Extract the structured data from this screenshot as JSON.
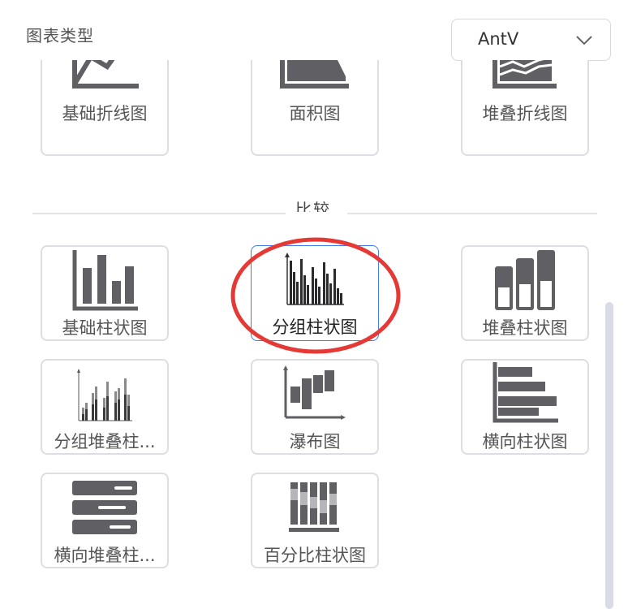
{
  "panel": {
    "title": "图表类型"
  },
  "library_select": {
    "value": "AntV",
    "icon": "chevron-down-icon"
  },
  "top_row": [
    {
      "label": "基础折线图",
      "icon": "line-chart-icon"
    },
    {
      "label": "面积图",
      "icon": "area-chart-icon"
    },
    {
      "label": "堆叠折线图",
      "icon": "stacked-line-chart-icon"
    }
  ],
  "section": {
    "title": "比较"
  },
  "compare_charts": [
    {
      "label": "基础柱状图",
      "icon": "bar-chart-icon"
    },
    {
      "label": "分组柱状图",
      "icon": "grouped-bar-chart-icon",
      "selected": true
    },
    {
      "label": "堆叠柱状图",
      "icon": "stacked-bar-chart-icon"
    },
    {
      "label": "分组堆叠柱...",
      "icon": "grouped-stacked-bar-chart-icon"
    },
    {
      "label": "瀑布图",
      "icon": "waterfall-chart-icon"
    },
    {
      "label": "横向柱状图",
      "icon": "horizontal-bar-chart-icon"
    },
    {
      "label": "横向堆叠柱...",
      "icon": "horizontal-stacked-bar-chart-icon"
    },
    {
      "label": "百分比柱状图",
      "icon": "percent-bar-chart-icon"
    }
  ],
  "colors": {
    "icon": "#606064",
    "selected_border": "#3e7bf5",
    "annotation_circle": "#e53935",
    "card_border": "#dcdee2"
  }
}
